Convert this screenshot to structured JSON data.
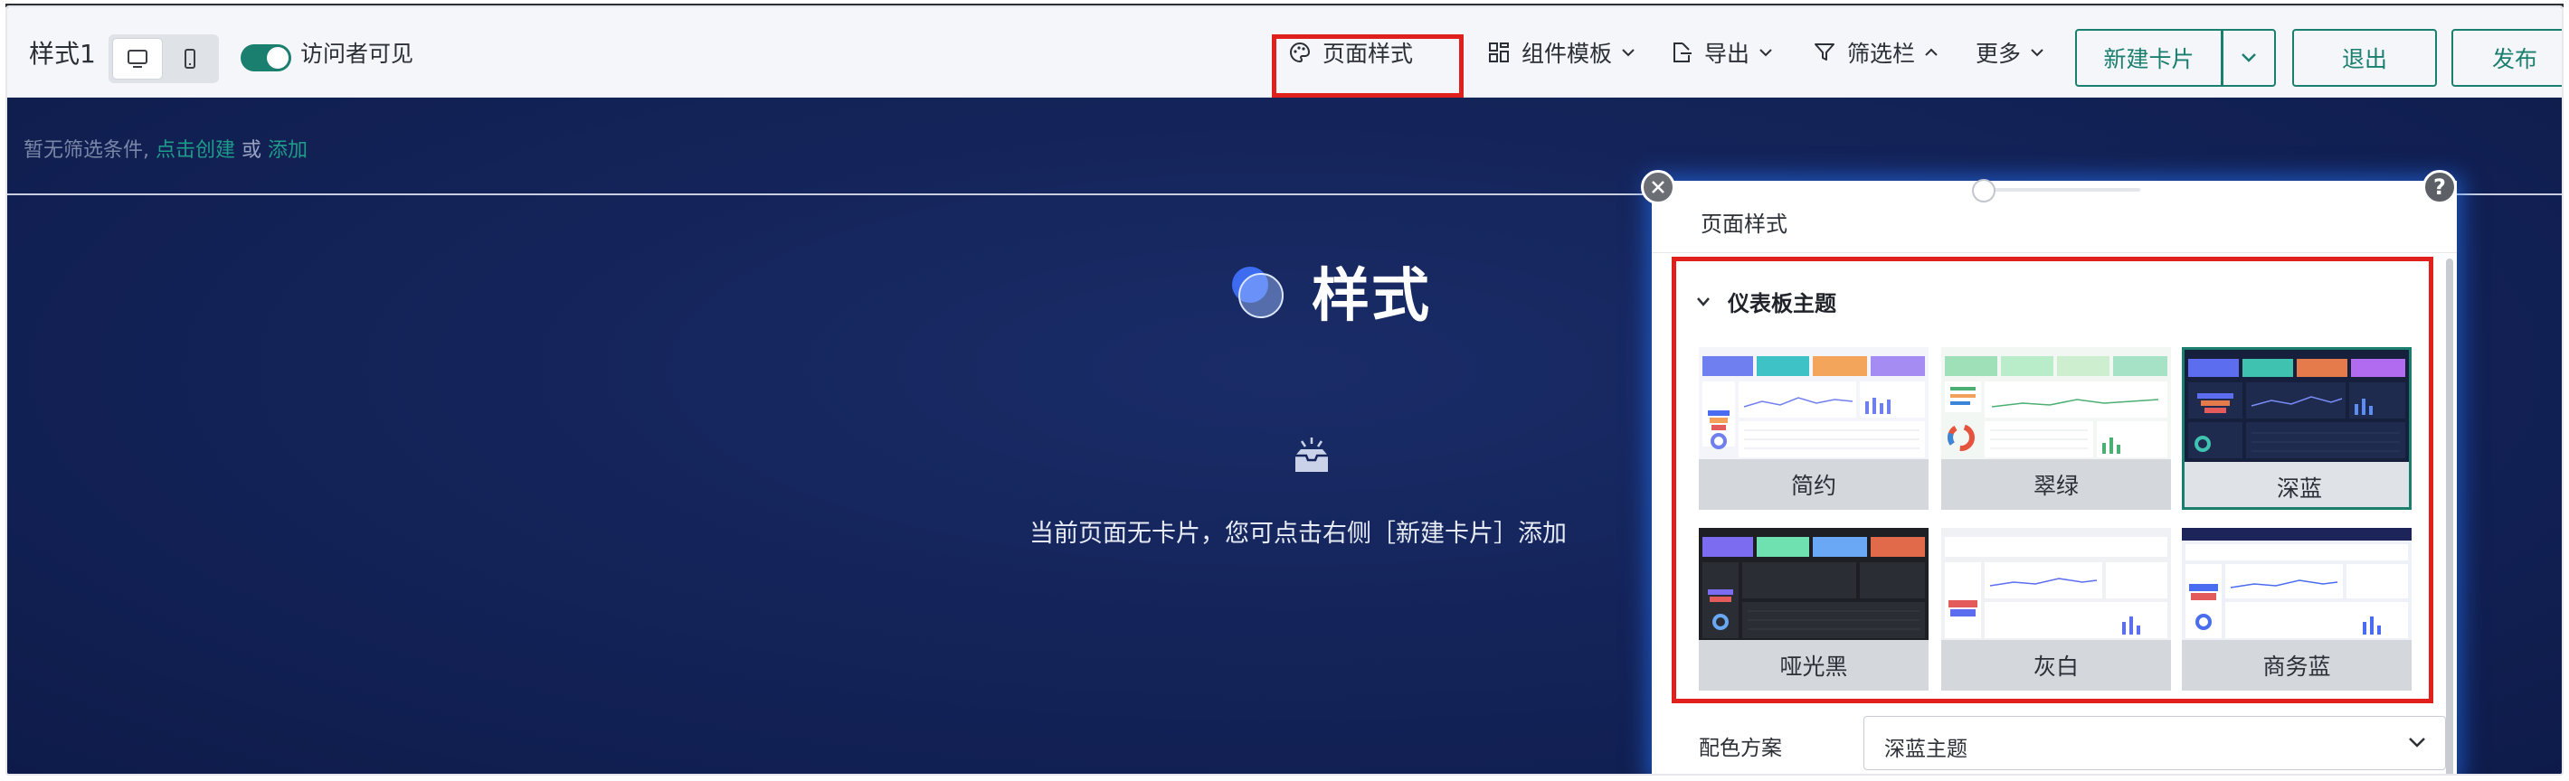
{
  "toolbar": {
    "page_title": "样式1",
    "visitor_label": "访问者可见",
    "page_style": "页面样式",
    "components": "组件模板",
    "export": "导出",
    "filter": "筛选栏",
    "more": "更多",
    "new_card": "新建卡片",
    "exit": "退出",
    "publish": "发布"
  },
  "filter_bar": {
    "empty_text": "暂无筛选条件,",
    "create_link": "点击创建",
    "or": "或",
    "add_link": "添加"
  },
  "canvas": {
    "title": "样式",
    "empty_message": "当前页面无卡片，您可点击右侧［新建卡片］添加"
  },
  "panel": {
    "title": "页面样式",
    "help": "?",
    "section_title": "仪表板主题",
    "themes": [
      {
        "name": "简约",
        "selected": false
      },
      {
        "name": "翠绿",
        "selected": false
      },
      {
        "name": "深蓝",
        "selected": true
      },
      {
        "name": "哑光黑",
        "selected": false
      },
      {
        "name": "灰白",
        "selected": false
      },
      {
        "name": "商务蓝",
        "selected": false
      }
    ],
    "palette_label": "配色方案",
    "palette_value": "深蓝主题"
  },
  "colors": {
    "accent": "#1a7f6f",
    "highlight": "#e0201c",
    "canvas_bg": "#14245a"
  }
}
